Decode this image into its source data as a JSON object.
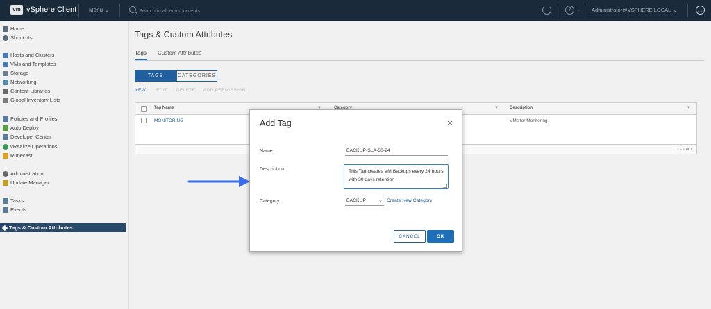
{
  "header": {
    "logo": "vm",
    "app_title": "vSphere Client",
    "menu_label": "Menu",
    "search_placeholder": "Search in all environments",
    "user": "Administrator@VSPHERE.LOCAL"
  },
  "sidebar": {
    "items": [
      {
        "label": "Home",
        "icon": "home-icon",
        "color": "#5a6a7a"
      },
      {
        "label": "Shortcuts",
        "icon": "shortcuts-icon",
        "color": "#5a6a7a"
      },
      {
        "label": "Hosts and Clusters",
        "icon": "hosts-icon",
        "color": "#4a7ab0"
      },
      {
        "label": "VMs and Templates",
        "icon": "vms-icon",
        "color": "#4a7ab0"
      },
      {
        "label": "Storage",
        "icon": "storage-icon",
        "color": "#6a7a8a"
      },
      {
        "label": "Networking",
        "icon": "networking-icon",
        "color": "#4a8ab0"
      },
      {
        "label": "Content Libraries",
        "icon": "library-icon",
        "color": "#6a6a6a"
      },
      {
        "label": "Global Inventory Lists",
        "icon": "inventory-icon",
        "color": "#7a7a7a"
      },
      {
        "label": "Policies and Profiles",
        "icon": "policies-icon",
        "color": "#5a7aa0"
      },
      {
        "label": "Auto Deploy",
        "icon": "auto-deploy-icon",
        "color": "#5aa040"
      },
      {
        "label": "Developer Center",
        "icon": "developer-icon",
        "color": "#5a7a9a"
      },
      {
        "label": "vRealize Operations",
        "icon": "vrealize-icon",
        "color": "#3a9a5a"
      },
      {
        "label": "Runecast",
        "icon": "runecast-icon",
        "color": "#e0a020"
      },
      {
        "label": "Administration",
        "icon": "administration-icon",
        "color": "#6a6a6a"
      },
      {
        "label": "Update Manager",
        "icon": "update-manager-icon",
        "color": "#c0a020"
      },
      {
        "label": "Tasks",
        "icon": "tasks-icon",
        "color": "#5a7a9a"
      },
      {
        "label": "Events",
        "icon": "events-icon",
        "color": "#5a7a9a"
      },
      {
        "label": "Tags & Custom Attributes",
        "icon": "tag-icon",
        "color": "#ffffff"
      }
    ]
  },
  "main": {
    "title": "Tags & Custom Attributes",
    "tabs": [
      "Tags",
      "Custom Attributes"
    ],
    "segments": [
      "TAGS",
      "CATEGORIES"
    ],
    "actions": [
      "NEW",
      "EDIT",
      "DELETE",
      "ADD PERMISSION"
    ],
    "table": {
      "columns": [
        "Tag Name",
        "Category",
        "Description"
      ],
      "rows": [
        {
          "tag": "MONITORING",
          "category": "",
          "description": "VMs for Monitoring"
        }
      ],
      "footer": "1 - 1 of 1"
    }
  },
  "dialog": {
    "title": "Add Tag",
    "name_label": "Name:",
    "name_value": "BACKUP-SLA-30-24",
    "description_label": "Description:",
    "description_value": "This Tag creates VM Backups every 24 hours with 30 days retention",
    "category_label": "Category:",
    "category_value": "BACKUP",
    "create_link": "Create New Category",
    "cancel_label": "CANCEL",
    "ok_label": "OK"
  },
  "colors": {
    "header_bg": "#1b2a3a",
    "accent": "#1f5f9f",
    "arrow": "#3a6ee8",
    "active_nav": "#2a4a6b"
  }
}
